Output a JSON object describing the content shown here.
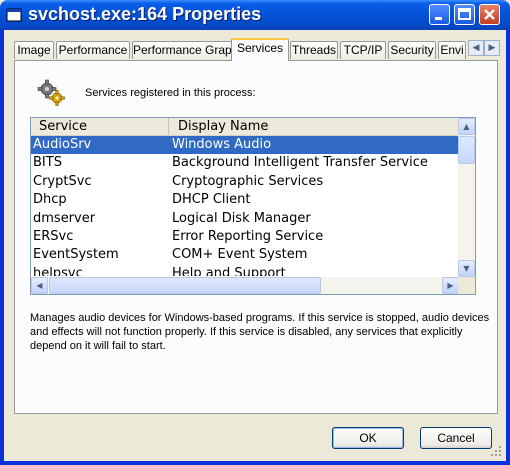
{
  "window": {
    "title": "svchost.exe:164 Properties"
  },
  "tabs": [
    {
      "label": "Image"
    },
    {
      "label": "Performance"
    },
    {
      "label": "Performance Graph"
    },
    {
      "label": "Services"
    },
    {
      "label": "Threads"
    },
    {
      "label": "TCP/IP"
    },
    {
      "label": "Security"
    },
    {
      "label": "Envi"
    }
  ],
  "active_tab": "Services",
  "services_page": {
    "intro": "Services registered in this process:",
    "columns": {
      "service": "Service",
      "display_name": "Display Name"
    },
    "rows": [
      {
        "service": "AudioSrv",
        "display": "Windows Audio",
        "selected": true
      },
      {
        "service": "BITS",
        "display": "Background Intelligent Transfer Service",
        "selected": false
      },
      {
        "service": "CryptSvc",
        "display": "Cryptographic Services",
        "selected": false
      },
      {
        "service": "Dhcp",
        "display": "DHCP Client",
        "selected": false
      },
      {
        "service": "dmserver",
        "display": "Logical Disk Manager",
        "selected": false
      },
      {
        "service": "ERSvc",
        "display": "Error Reporting Service",
        "selected": false
      },
      {
        "service": "EventSystem",
        "display": "COM+ Event System",
        "selected": false
      },
      {
        "service": "helpsvc",
        "display": "Help and Support",
        "selected": false
      }
    ],
    "description": "Manages audio devices for Windows-based programs.  If this service is stopped, audio devices and effects will not function properly.  If this service is disabled, any services that explicitly depend on it will fail to start."
  },
  "buttons": {
    "ok": "OK",
    "cancel": "Cancel"
  },
  "colors": {
    "title_bar": "#0a5ee8",
    "selection": "#316ac5",
    "tab_highlight": "#ffc73c",
    "dialog_bg": "#ece9d8"
  },
  "icons": {
    "window": "window-app-icon",
    "services": "gears-icon"
  }
}
